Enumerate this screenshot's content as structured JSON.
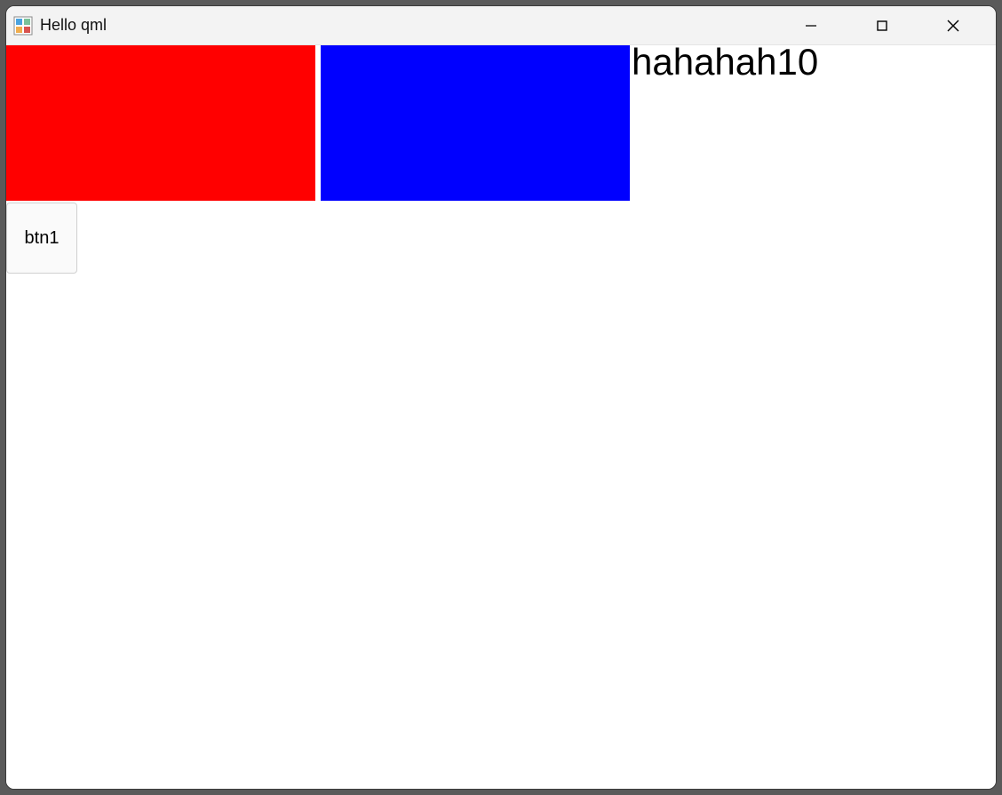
{
  "window": {
    "title": "Hello qml"
  },
  "content": {
    "label": "hahahah10",
    "button1": "btn1"
  },
  "colors": {
    "rect1": "#ff0000",
    "rect2": "#0000ff"
  }
}
